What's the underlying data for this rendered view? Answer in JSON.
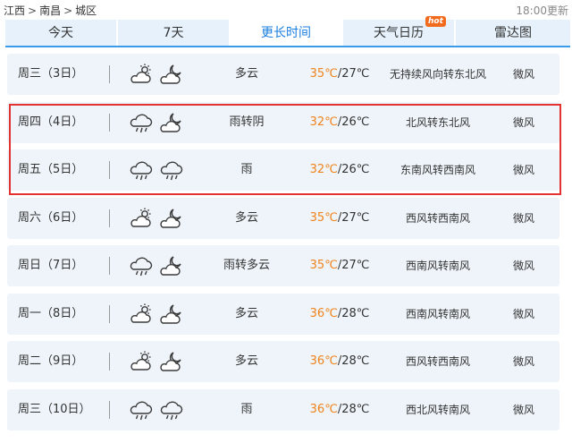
{
  "breadcrumb": [
    "江西",
    "南昌",
    "城区"
  ],
  "breadcrumb_sep": ">",
  "update_time": "18:00更新",
  "tabs": [
    {
      "label": "今天",
      "active": false
    },
    {
      "label": "7天",
      "active": false
    },
    {
      "label": "更长时间",
      "active": true
    },
    {
      "label": "天气日历",
      "active": false,
      "badge": "hot"
    },
    {
      "label": "雷达图",
      "active": false
    }
  ],
  "colors": {
    "accent": "#1a7ee0",
    "high_temp": "#f0831b",
    "highlight": "#e23232",
    "row_bg": "#eef4fa"
  },
  "days": [
    {
      "day": "周三（3日）",
      "day_icon": "partly-cloudy-icon",
      "night_icon": "cloudy-night-icon",
      "weather": "多云",
      "high": "35℃",
      "low": "/27℃",
      "wind": "无持续风向转东北风",
      "level": "微风"
    },
    {
      "day": "周四（4日）",
      "day_icon": "rain-icon",
      "night_icon": "cloudy-night-icon",
      "weather": "雨转阴",
      "high": "32℃",
      "low": "/26℃",
      "wind": "北风转东北风",
      "level": "微风"
    },
    {
      "day": "周五（5日）",
      "day_icon": "rain-icon",
      "night_icon": "rain-icon",
      "weather": "雨",
      "high": "32℃",
      "low": "/26℃",
      "wind": "东南风转西南风",
      "level": "微风"
    },
    {
      "day": "周六（6日）",
      "day_icon": "partly-cloudy-icon",
      "night_icon": "cloudy-night-icon",
      "weather": "多云",
      "high": "35℃",
      "low": "/27℃",
      "wind": "西风转西南风",
      "level": "微风"
    },
    {
      "day": "周日（7日）",
      "day_icon": "rain-icon",
      "night_icon": "cloudy-night-icon",
      "weather": "雨转多云",
      "high": "35℃",
      "low": "/27℃",
      "wind": "西南风转南风",
      "level": "微风"
    },
    {
      "day": "周一（8日）",
      "day_icon": "partly-cloudy-icon",
      "night_icon": "cloudy-night-icon",
      "weather": "多云",
      "high": "36℃",
      "low": "/28℃",
      "wind": "西南风转南风",
      "level": "微风"
    },
    {
      "day": "周二（9日）",
      "day_icon": "partly-cloudy-icon",
      "night_icon": "cloudy-night-icon",
      "weather": "多云",
      "high": "36℃",
      "low": "/28℃",
      "wind": "西风转西南风",
      "level": "微风"
    },
    {
      "day": "周三（10日）",
      "day_icon": "rain-icon",
      "night_icon": "rain-icon",
      "weather": "雨",
      "high": "36℃",
      "low": "/28℃",
      "wind": "西北风转南风",
      "level": "微风"
    }
  ]
}
